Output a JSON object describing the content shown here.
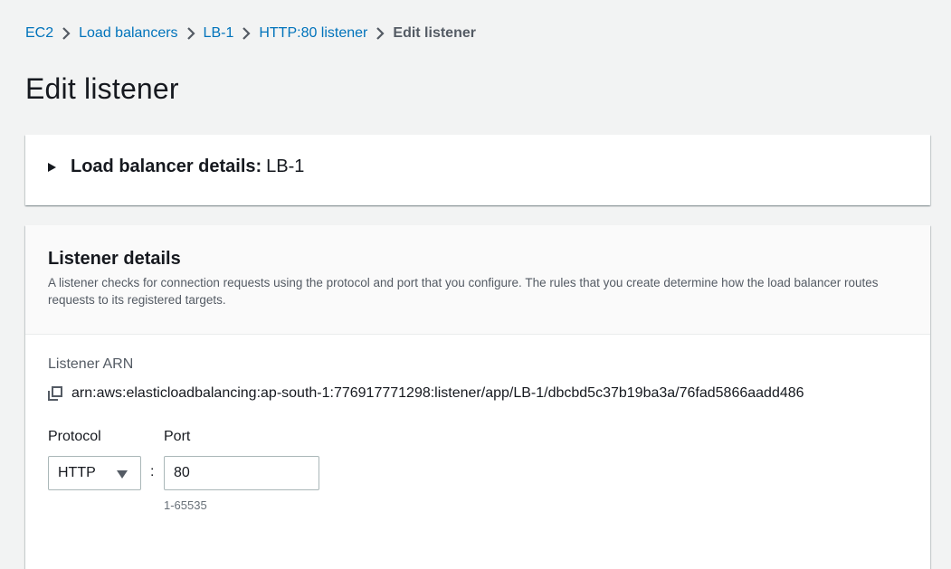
{
  "breadcrumb": {
    "items": [
      "EC2",
      "Load balancers",
      "LB-1",
      "HTTP:80 listener"
    ],
    "current": "Edit listener"
  },
  "page_title": "Edit listener",
  "lb_details": {
    "label": "Load balancer details:",
    "value": "LB-1"
  },
  "listener": {
    "title": "Listener details",
    "description": "A listener checks for connection requests using the protocol and port that you configure. The rules that you create determine how the load balancer routes requests to its registered targets.",
    "arn_label": "Listener ARN",
    "arn": "arn:aws:elasticloadbalancing:ap-south-1:776917771298:listener/app/LB-1/dbcbd5c37b19ba3a/76fad5866aadd486",
    "protocol_label": "Protocol",
    "protocol_value": "HTTP",
    "port_label": "Port",
    "port_value": "80",
    "port_constraint": "1-65535",
    "colon": ":"
  },
  "colors": {
    "link": "#0073bb",
    "background": "#f2f3f3",
    "text": "#16191f",
    "secondary_text": "#545b64"
  },
  "icons": [
    "chevron-right-icon",
    "caret-right-icon",
    "copy-icon",
    "caret-down-icon"
  ]
}
